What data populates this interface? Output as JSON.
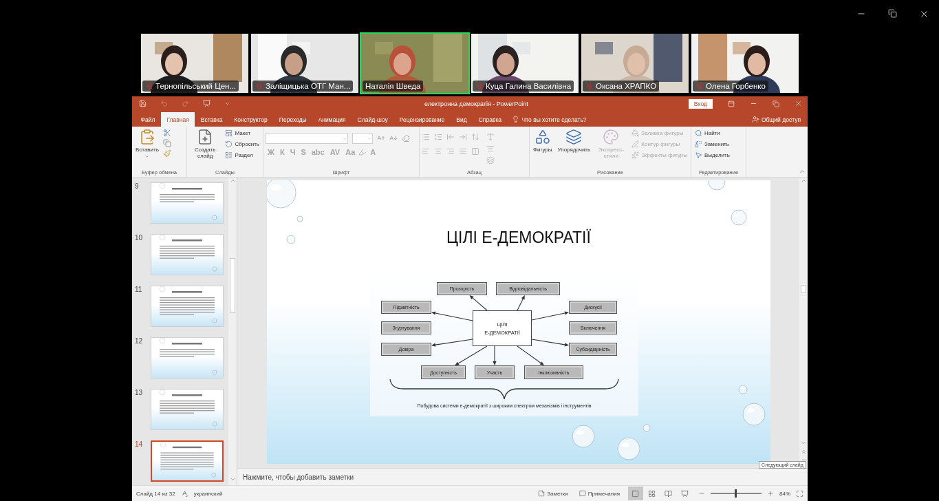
{
  "participants": [
    {
      "name": "Тернопільський Цен...",
      "muted": true,
      "speaking": false
    },
    {
      "name": "Заліщицька ОТГ Ман...",
      "muted": true,
      "speaking": false
    },
    {
      "name": "Наталія Шведа",
      "muted": false,
      "speaking": true
    },
    {
      "name": "Куца Галина Василівна",
      "muted": true,
      "speaking": false
    },
    {
      "name": "Оксана ХРАПКО",
      "muted": true,
      "speaking": false
    },
    {
      "name": "Олена Горбенко",
      "muted": true,
      "speaking": false
    }
  ],
  "powerpoint": {
    "title": "електронна демократія - PowerPoint",
    "sign_in": "Вход",
    "tabs": [
      {
        "label": "Файл",
        "selected": false
      },
      {
        "label": "Главная",
        "selected": true
      },
      {
        "label": "Вставка",
        "selected": false
      },
      {
        "label": "Конструктор",
        "selected": false
      },
      {
        "label": "Переходы",
        "selected": false
      },
      {
        "label": "Анимация",
        "selected": false
      },
      {
        "label": "Слайд-шоу",
        "selected": false
      },
      {
        "label": "Рецензирование",
        "selected": false
      },
      {
        "label": "Вид",
        "selected": false
      },
      {
        "label": "Справка",
        "selected": false
      }
    ],
    "tell_me": "Что вы хотите сделать?",
    "share": "Общий доступ",
    "ribbon": {
      "clipboard": {
        "label": "Буфер обмена",
        "paste": "Вставить"
      },
      "slides": {
        "label": "Слайды",
        "new_slide": "Создать слайд",
        "items": [
          "Макет",
          "Сбросить",
          "Раздел"
        ]
      },
      "font": {
        "label": "Шрифт",
        "format_buttons": [
          {
            "label": "Ж",
            "disabled": true
          },
          {
            "label": "К",
            "disabled": true
          },
          {
            "label": "Ч",
            "disabled": true
          },
          {
            "label": "S",
            "disabled": true
          },
          {
            "label": "abc",
            "disabled": true
          },
          {
            "label": "AV",
            "disabled": true
          },
          {
            "label": "Aa",
            "disabled": true
          },
          {
            "label": "A",
            "disabled": true
          }
        ]
      },
      "paragraph": {
        "label": "Абзац"
      },
      "drawing": {
        "label": "Рисование",
        "big_buttons": [
          {
            "label": "Фигуры",
            "disabled": false
          },
          {
            "label": "Упорядочить",
            "disabled": false
          },
          {
            "label": "Экспресс-стили",
            "disabled": true
          }
        ],
        "items": [
          {
            "label": "Заливка фигуры",
            "disabled": true
          },
          {
            "label": "Контур фигуры",
            "disabled": true
          },
          {
            "label": "Эффекты фигуры",
            "disabled": true
          }
        ]
      },
      "editing": {
        "label": "Редактирование",
        "items": [
          "Найти",
          "Заменить",
          "Выделить"
        ]
      }
    },
    "thumbnails": [
      {
        "number": "9",
        "selected": false
      },
      {
        "number": "10",
        "selected": false
      },
      {
        "number": "11",
        "selected": false
      },
      {
        "number": "12",
        "selected": false
      },
      {
        "number": "13",
        "selected": false
      },
      {
        "number": "14",
        "selected": true
      }
    ],
    "slide": {
      "title": "ЦІЛІ Е-ДЕМОКРАТІЇ",
      "diagram": {
        "center": [
          "ЦІЛІ",
          "Е-ДЕМОКРАТІЇ"
        ],
        "nodes": [
          {
            "label": "Прозорість",
            "arrow": true
          },
          {
            "label": "Відповідальність",
            "arrow": true
          },
          {
            "label": "Підзвітність",
            "arrow": true
          },
          {
            "label": "Згуртування",
            "arrow": false
          },
          {
            "label": "Довіра",
            "arrow": true
          },
          {
            "label": "Дискусії",
            "arrow": true
          },
          {
            "label": "Включення",
            "arrow": false
          },
          {
            "label": "Субсидіарність",
            "arrow": true
          },
          {
            "label": "Доступність",
            "arrow": true
          },
          {
            "label": "Участь",
            "arrow": true
          },
          {
            "label": "Інклюзивність",
            "arrow": true
          }
        ],
        "caption": "Побудова системи е-демократії з широким спектром механізмів і інструментів"
      }
    },
    "notes_placeholder": "Нажмите, чтобы добавить заметки",
    "tooltip": "Следующий слайд",
    "status_bar": {
      "slide": "Слайд 14 из 32",
      "language": "украинский",
      "notes": "Заметки",
      "comments": "Примечания",
      "views": [
        {
          "selected": true
        },
        {
          "selected": false
        },
        {
          "selected": false
        },
        {
          "selected": false
        }
      ],
      "zoom": {
        "level": 0.48,
        "reading": "84%"
      }
    }
  }
}
